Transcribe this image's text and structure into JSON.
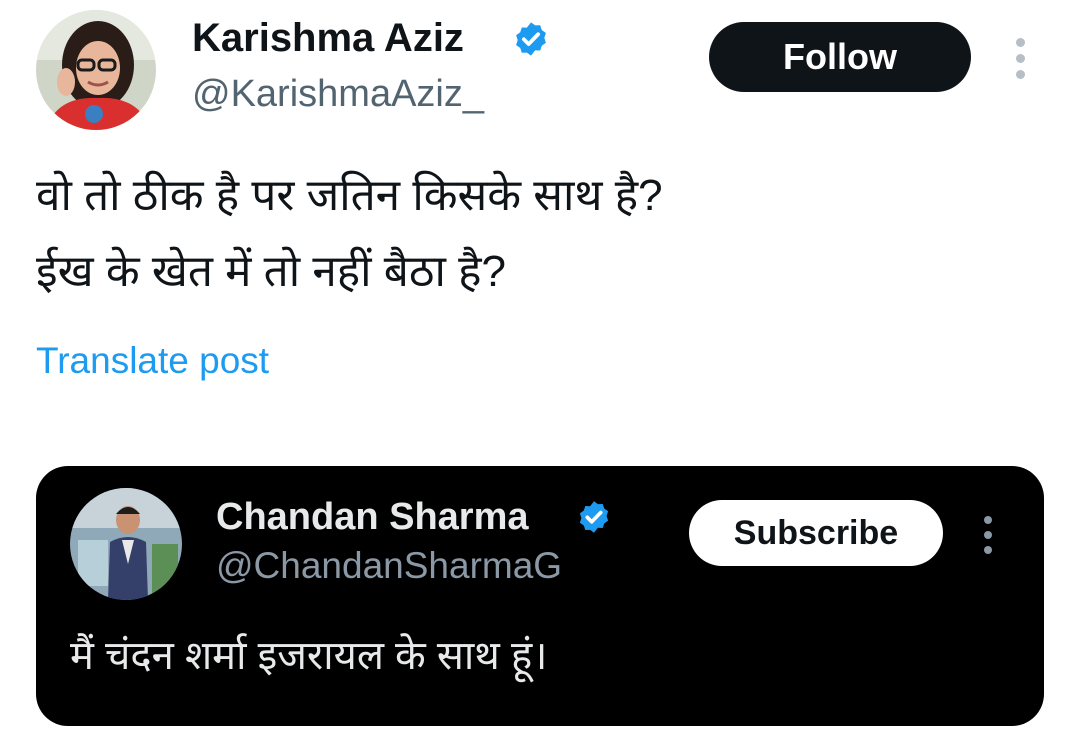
{
  "tweet": {
    "author": {
      "name": "Karishma Aziz",
      "handle": "@KarishmaAziz_",
      "verified": true
    },
    "follow_label": "Follow",
    "more_icon": "more-vertical-icon",
    "text_lines": [
      "वो तो ठीक है पर जतिन किसके साथ है?",
      "ईख के खेत में तो नहीं बैठा है?"
    ],
    "translate_label": "Translate post"
  },
  "quoted": {
    "author": {
      "name": "Chandan Sharma",
      "handle": "@ChandanSharmaG",
      "verified": true
    },
    "subscribe_label": "Subscribe",
    "more_icon": "more-vertical-icon",
    "text": "मैं चंदन शर्मा इजरायल के साथ हूं।"
  },
  "colors": {
    "verified_badge": "#1d9bf0",
    "link": "#1d9bf0",
    "follow_bg": "#0f1419",
    "quote_card_bg": "#000000"
  }
}
